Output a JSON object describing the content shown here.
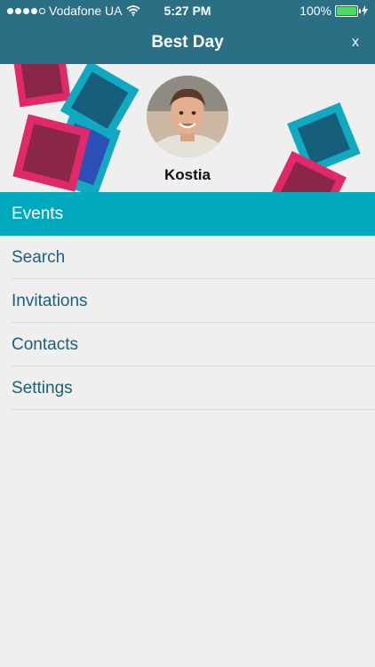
{
  "status": {
    "carrier": "Vodafone UA",
    "time": "5:27 PM",
    "battery": "100%"
  },
  "header": {
    "title": "Best Day",
    "close_label": "x"
  },
  "profile": {
    "name": "Kostia"
  },
  "menu": {
    "items": [
      {
        "label": "Events",
        "active": true
      },
      {
        "label": "Search",
        "active": false
      },
      {
        "label": "Invitations",
        "active": false
      },
      {
        "label": "Contacts",
        "active": false
      },
      {
        "label": "Settings",
        "active": false
      }
    ]
  },
  "colors": {
    "topbar": "#2a6f84",
    "active_item": "#00a9bd",
    "menu_text": "#1b5f7a",
    "pink": "#e0286a",
    "teal": "#11a8c2",
    "blue": "#2a4fb5"
  }
}
